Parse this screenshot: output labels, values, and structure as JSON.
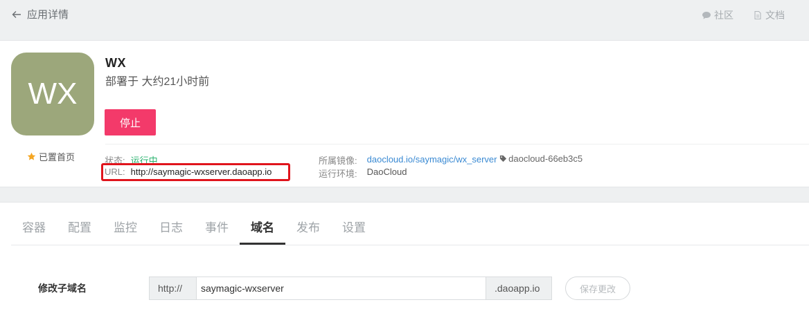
{
  "header": {
    "back_label": "应用详情",
    "links": [
      {
        "label": "社区",
        "icon": "comment-icon"
      },
      {
        "label": "文档",
        "icon": "document-icon"
      }
    ]
  },
  "app": {
    "avatar_text": "WX",
    "avatar_color": "#9ca77b",
    "name": "WX",
    "deployed": "部署于 大约21小时前",
    "stop_label": "停止",
    "starred_label": "已置首页",
    "status_key": "状态:",
    "status_value": "运行中",
    "url_key": "URL:",
    "url_value": "http://saymagic-wxserver.daoapp.io",
    "image_key": "所属镜像:",
    "image_value": "daocloud.io/saymagic/wx_server",
    "image_tag": "daocloud-66eb3c5",
    "env_key": "运行环境:",
    "env_value": "DaoCloud"
  },
  "tabs": [
    "容器",
    "配置",
    "监控",
    "日志",
    "事件",
    "域名",
    "发布",
    "设置"
  ],
  "active_tab": "域名",
  "domain_form": {
    "label": "修改子域名",
    "prefix": "http://",
    "value": "saymagic-wxserver",
    "suffix": ".daoapp.io",
    "save_label": "保存更改"
  },
  "colors": {
    "stop_button": "#f33a6a",
    "status_running": "#2ab26e",
    "link": "#3a8ad3",
    "highlight_box": "#e0141c"
  }
}
